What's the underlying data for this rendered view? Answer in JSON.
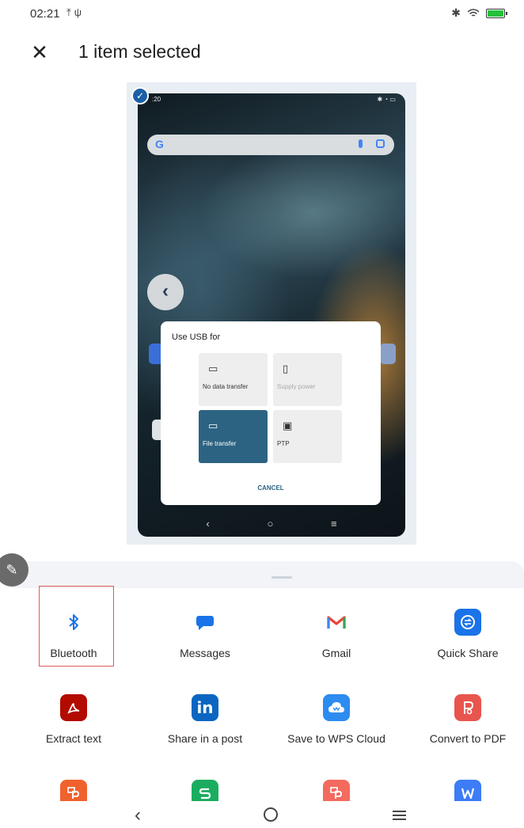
{
  "status_bar": {
    "time": "02:21",
    "left_icons": [
      "upload-icon",
      "usb-icon"
    ],
    "right_icons": [
      "bluetooth-icon",
      "wifi-icon",
      "battery-icon"
    ],
    "battery_level": 1.0,
    "battery_color": "#22c33a"
  },
  "header": {
    "close_icon": "close-icon",
    "title": "1 item selected"
  },
  "preview": {
    "selected": true,
    "screenshot": {
      "status_time": ":20",
      "dialog": {
        "title": "Use USB for",
        "options": [
          {
            "label": "No data transfer",
            "icon": "battery-charging-icon",
            "state": "normal"
          },
          {
            "label": "Supply power",
            "icon": "phone-power-icon",
            "state": "disabled"
          },
          {
            "label": "File transfer",
            "icon": "folder-icon",
            "state": "selected"
          },
          {
            "label": "PTP",
            "icon": "image-icon",
            "state": "normal"
          }
        ],
        "cancel": "CANCEL"
      }
    }
  },
  "share_targets": [
    {
      "label": "Bluetooth",
      "icon": "bluetooth-icon",
      "color": "#1a73e8"
    },
    {
      "label": "Messages",
      "icon": "messages-icon",
      "color": "#1a73e8"
    },
    {
      "label": "Gmail",
      "icon": "gmail-icon",
      "color": "#ea4335"
    },
    {
      "label": "Quick Share",
      "icon": "quick-share-icon",
      "color": "#1a73e8"
    },
    {
      "label": "Extract text",
      "icon": "acrobat-icon",
      "color": "#b30b00"
    },
    {
      "label": "Share in a post",
      "icon": "linkedin-icon",
      "color": "#0a66c2"
    },
    {
      "label": "Save to WPS Cloud",
      "icon": "wps-cloud-icon",
      "color": "#2d8cf0"
    },
    {
      "label": "Convert to PDF",
      "icon": "convert-pdf-icon",
      "color": "#e8554e"
    },
    {
      "label": "",
      "icon": "wps-presentation-icon",
      "color": "#f0622d"
    },
    {
      "label": "",
      "icon": "wps-spreadsheet-icon",
      "color": "#1aad5f"
    },
    {
      "label": "",
      "icon": "wps-pdf-icon",
      "color": "#f46a5e"
    },
    {
      "label": "",
      "icon": "wps-writer-icon",
      "color": "#3d7cf5"
    }
  ],
  "highlighted_target": "Bluetooth",
  "highlight_color": "#e05a5a",
  "nav_bar": {
    "icons": [
      "back-icon",
      "home-icon",
      "menu-icon"
    ]
  }
}
